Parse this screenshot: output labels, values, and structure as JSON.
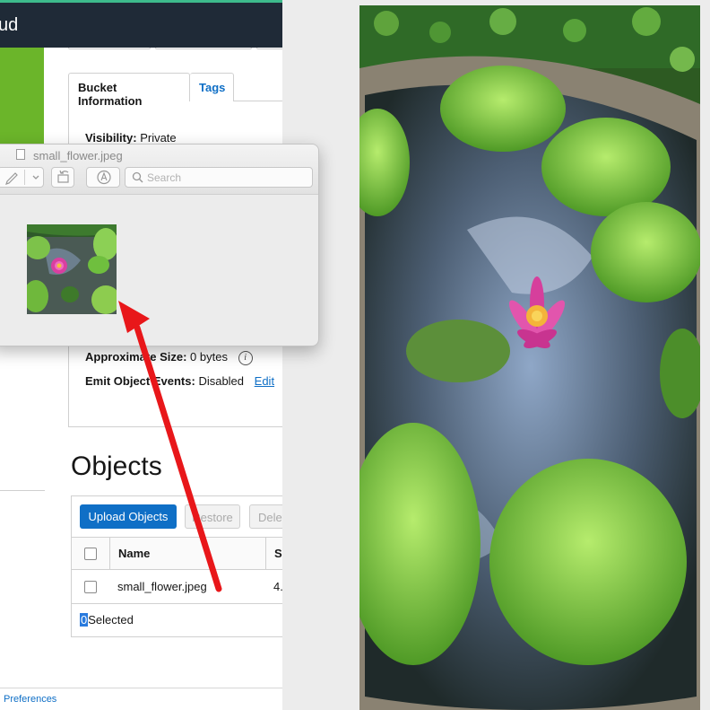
{
  "console": {
    "brand": "ud",
    "tabs": [
      {
        "label": "Bucket Information"
      },
      {
        "label": "Tags"
      }
    ],
    "info": {
      "visibility_label": "Visibility:",
      "visibility_value": "Private",
      "size_label": "Approximate Size:",
      "size_value": "0 bytes",
      "emit_label": "Emit Object Events:",
      "emit_value": "Disabled",
      "edit_label": "Edit"
    },
    "objects": {
      "title": "Objects",
      "upload_label": "Upload Objects",
      "restore_label": "Restore",
      "delete_label": "Delete",
      "col_name": "Name",
      "col_size": "S",
      "rows": [
        {
          "name": "small_flower.jpeg",
          "size": "4."
        }
      ],
      "selected_count": "0",
      "selected_label": "Selected"
    },
    "footer": {
      "preferences": "Preferences"
    }
  },
  "preview": {
    "title": "small_flower.jpeg",
    "search_placeholder": "Search"
  },
  "colors": {
    "topbar": "#1f2a37",
    "accent_green": "#6bb52a",
    "link_blue": "#0f6fc6",
    "arrow_red": "#e8171a"
  }
}
